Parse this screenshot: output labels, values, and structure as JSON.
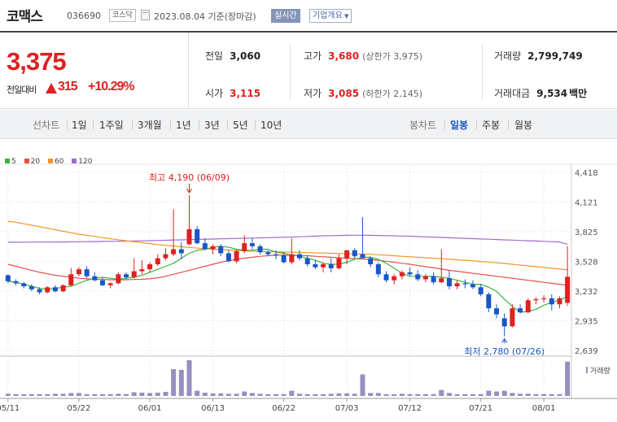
{
  "header": {
    "name": "코맥스",
    "code": "036690",
    "market": "코스닥",
    "date": "2023.08.04",
    "date_suffix": "기준(장마감)",
    "realtime_label": "실시간",
    "overview_label": "기업개요"
  },
  "quote": {
    "price": "3,375",
    "change_label": "전일대비",
    "change": "315",
    "change_pct": "+10.29%",
    "prev_close_label": "전일",
    "prev_close": "3,060",
    "high_label": "고가",
    "high": "3,680",
    "upper_limit": "(상한가 3,975)",
    "volume_label": "거래량",
    "volume": "2,799,749",
    "open_label": "시가",
    "open": "3,115",
    "low_label": "저가",
    "low": "3,085",
    "lower_limit": "(하한가 2,145)",
    "amount_label": "거래대금",
    "amount": "9,534",
    "amount_unit": "백만"
  },
  "tabs": {
    "line_label": "선차트",
    "line_periods": [
      "1일",
      "1주일",
      "3개월",
      "1년",
      "3년",
      "5년",
      "10년"
    ],
    "candle_label": "봉차트",
    "candle_periods": [
      "일봉",
      "주봉",
      "월봉"
    ],
    "selected_candle": "일봉"
  },
  "colors": {
    "up": "#e02020",
    "down": "#1a56c8",
    "ma5": "#3cb43c",
    "ma20": "#e8504a",
    "ma60": "#f0962a",
    "ma120": "#a06acc",
    "volume": "#9590c0"
  },
  "chart_data": {
    "type": "candlestick",
    "legend": [
      "5",
      "20",
      "60",
      "120"
    ],
    "y_ticks": [
      "4,418",
      "4,121",
      "3,825",
      "3,528",
      "3,232",
      "2,935",
      "2,639"
    ],
    "ylim": [
      2639,
      4418
    ],
    "x_ticks": [
      "05/11",
      "05/22",
      "06/01",
      "06/13",
      "06/22",
      "07/03",
      "07/12",
      "07/21",
      "08/01"
    ],
    "x_tick_index": [
      0,
      9,
      18,
      26,
      35,
      43,
      51,
      60,
      68
    ],
    "max_label": "최고 4,190 (06/09)",
    "max_index": 23,
    "max_value": 4190,
    "min_label": "최저 2,780 (07/26)",
    "min_index": 63,
    "min_value": 2780,
    "volume_label": "거래량",
    "candles": [
      [
        3390,
        3400,
        3310,
        3330
      ],
      [
        3330,
        3350,
        3290,
        3310
      ],
      [
        3310,
        3320,
        3260,
        3280
      ],
      [
        3280,
        3300,
        3230,
        3250
      ],
      [
        3250,
        3270,
        3200,
        3220
      ],
      [
        3220,
        3280,
        3210,
        3270
      ],
      [
        3270,
        3290,
        3220,
        3230
      ],
      [
        3230,
        3300,
        3220,
        3290
      ],
      [
        3290,
        3460,
        3280,
        3400
      ],
      [
        3400,
        3470,
        3380,
        3450
      ],
      [
        3450,
        3480,
        3360,
        3380
      ],
      [
        3380,
        3420,
        3330,
        3340
      ],
      [
        3340,
        3370,
        3280,
        3290
      ],
      [
        3290,
        3320,
        3260,
        3310
      ],
      [
        3310,
        3420,
        3300,
        3400
      ],
      [
        3400,
        3420,
        3350,
        3370
      ],
      [
        3370,
        3560,
        3360,
        3430
      ],
      [
        3430,
        3540,
        3400,
        3450
      ],
      [
        3450,
        3520,
        3420,
        3500
      ],
      [
        3500,
        3600,
        3480,
        3560
      ],
      [
        3560,
        3660,
        3540,
        3600
      ],
      [
        3600,
        4050,
        3580,
        3650
      ],
      [
        3650,
        3720,
        3550,
        3610
      ],
      [
        3700,
        4190,
        3690,
        3850
      ],
      [
        3850,
        3880,
        3700,
        3710
      ],
      [
        3710,
        3760,
        3640,
        3650
      ],
      [
        3650,
        3700,
        3600,
        3680
      ],
      [
        3680,
        3700,
        3580,
        3610
      ],
      [
        3610,
        3640,
        3520,
        3530
      ],
      [
        3530,
        3650,
        3510,
        3630
      ],
      [
        3630,
        3790,
        3610,
        3710
      ],
      [
        3710,
        3760,
        3650,
        3680
      ],
      [
        3680,
        3700,
        3600,
        3620
      ],
      [
        3620,
        3640,
        3580,
        3600
      ],
      [
        3600,
        3640,
        3550,
        3590
      ],
      [
        3590,
        3620,
        3510,
        3520
      ],
      [
        3520,
        3760,
        3500,
        3600
      ],
      [
        3600,
        3640,
        3540,
        3560
      ],
      [
        3560,
        3590,
        3480,
        3500
      ],
      [
        3500,
        3540,
        3450,
        3470
      ],
      [
        3470,
        3520,
        3420,
        3500
      ],
      [
        3500,
        3560,
        3420,
        3460
      ],
      [
        3460,
        3600,
        3450,
        3560
      ],
      [
        3560,
        3620,
        3500,
        3640
      ],
      [
        3640,
        3660,
        3560,
        3580
      ],
      [
        3600,
        3970,
        3560,
        3560
      ],
      [
        3560,
        3580,
        3470,
        3500
      ],
      [
        3500,
        3520,
        3370,
        3400
      ],
      [
        3400,
        3430,
        3320,
        3340
      ],
      [
        3340,
        3400,
        3300,
        3380
      ],
      [
        3380,
        3440,
        3350,
        3420
      ],
      [
        3420,
        3470,
        3380,
        3400
      ],
      [
        3400,
        3440,
        3330,
        3350
      ],
      [
        3350,
        3400,
        3320,
        3380
      ],
      [
        3380,
        3420,
        3300,
        3320
      ],
      [
        3320,
        3650,
        3310,
        3360
      ],
      [
        3360,
        3440,
        3250,
        3280
      ],
      [
        3280,
        3340,
        3250,
        3310
      ],
      [
        3310,
        3350,
        3260,
        3300
      ],
      [
        3300,
        3340,
        3250,
        3270
      ],
      [
        3270,
        3300,
        3180,
        3200
      ],
      [
        3200,
        3220,
        3020,
        3060
      ],
      [
        3060,
        3100,
        2960,
        3000
      ],
      [
        2960,
        3010,
        2780,
        2880
      ],
      [
        2880,
        3100,
        2870,
        3060
      ],
      [
        3060,
        3100,
        3010,
        3020
      ],
      [
        3020,
        3160,
        3010,
        3140
      ],
      [
        3140,
        3170,
        3100,
        3150
      ],
      [
        3150,
        3190,
        3120,
        3160
      ],
      [
        3160,
        3200,
        3040,
        3100
      ],
      [
        3100,
        3180,
        3060,
        3160
      ],
      [
        3115,
        3680,
        3085,
        3375
      ]
    ],
    "volumes": [
      6,
      5,
      5,
      5,
      5,
      5,
      6,
      6,
      8,
      8,
      5,
      5,
      5,
      5,
      6,
      5,
      10,
      9,
      8,
      9,
      11,
      72,
      70,
      96,
      14,
      9,
      7,
      7,
      6,
      6,
      12,
      8,
      6,
      5,
      5,
      5,
      14,
      6,
      5,
      5,
      5,
      6,
      7,
      7,
      6,
      58,
      8,
      8,
      5,
      5,
      6,
      5,
      5,
      5,
      5,
      16,
      8,
      5,
      5,
      5,
      5,
      14,
      12,
      14,
      8,
      6,
      6,
      5,
      5,
      5,
      5,
      92
    ],
    "ma5": [
      3330,
      3320,
      3300,
      3280,
      3260,
      3250,
      3260,
      3270,
      3280,
      3310,
      3340,
      3360,
      3370,
      3360,
      3350,
      3360,
      3370,
      3390,
      3420,
      3450,
      3480,
      3510,
      3560,
      3610,
      3640,
      3650,
      3670,
      3680,
      3670,
      3650,
      3640,
      3640,
      3650,
      3650,
      3620,
      3610,
      3590,
      3580,
      3560,
      3540,
      3510,
      3500,
      3500,
      3520,
      3550,
      3570,
      3570,
      3550,
      3510,
      3460,
      3410,
      3380,
      3380,
      3380,
      3380,
      3370,
      3360,
      3340,
      3320,
      3300,
      3300,
      3270,
      3230,
      3150,
      3080,
      3020,
      3030,
      3050,
      3090,
      3120,
      3140,
      3180
    ],
    "ma20": [
      3500,
      3480,
      3460,
      3440,
      3420,
      3405,
      3390,
      3380,
      3370,
      3360,
      3355,
      3350,
      3348,
      3346,
      3345,
      3346,
      3348,
      3350,
      3355,
      3365,
      3380,
      3400,
      3420,
      3440,
      3460,
      3480,
      3500,
      3520,
      3535,
      3550,
      3560,
      3570,
      3580,
      3585,
      3590,
      3590,
      3590,
      3588,
      3585,
      3580,
      3575,
      3570,
      3565,
      3560,
      3556,
      3552,
      3548,
      3540,
      3530,
      3520,
      3510,
      3500,
      3488,
      3476,
      3464,
      3452,
      3440,
      3430,
      3420,
      3410,
      3400,
      3390,
      3380,
      3370,
      3360,
      3350,
      3340,
      3330,
      3320,
      3310,
      3300,
      3290
    ],
    "ma60": [
      3930,
      3920,
      3905,
      3890,
      3875,
      3860,
      3845,
      3830,
      3815,
      3800,
      3790,
      3778,
      3766,
      3755,
      3745,
      3735,
      3725,
      3715,
      3706,
      3697,
      3690,
      3682,
      3675,
      3668,
      3662,
      3656,
      3651,
      3646,
      3642,
      3638,
      3634,
      3631,
      3628,
      3626,
      3624,
      3622,
      3620,
      3618,
      3616,
      3614,
      3612,
      3610,
      3608,
      3606,
      3604,
      3602,
      3600,
      3595,
      3590,
      3585,
      3580,
      3575,
      3570,
      3565,
      3560,
      3555,
      3550,
      3545,
      3540,
      3535,
      3528,
      3522,
      3515,
      3508,
      3500,
      3492,
      3484,
      3476,
      3468,
      3460,
      3452,
      3444
    ],
    "ma120": [
      3720,
      3720,
      3721,
      3721,
      3722,
      3722,
      3723,
      3723,
      3724,
      3725,
      3726,
      3727,
      3728,
      3729,
      3730,
      3731,
      3732,
      3734,
      3736,
      3738,
      3740,
      3742,
      3744,
      3746,
      3748,
      3750,
      3752,
      3754,
      3756,
      3758,
      3760,
      3762,
      3764,
      3766,
      3768,
      3770,
      3772,
      3775,
      3778,
      3781,
      3784,
      3786,
      3788,
      3789,
      3790,
      3790,
      3789,
      3788,
      3786,
      3784,
      3782,
      3780,
      3777,
      3774,
      3771,
      3768,
      3765,
      3762,
      3759,
      3756,
      3753,
      3750,
      3747,
      3744,
      3741,
      3738,
      3735,
      3732,
      3729,
      3726,
      3723,
      3700
    ]
  }
}
